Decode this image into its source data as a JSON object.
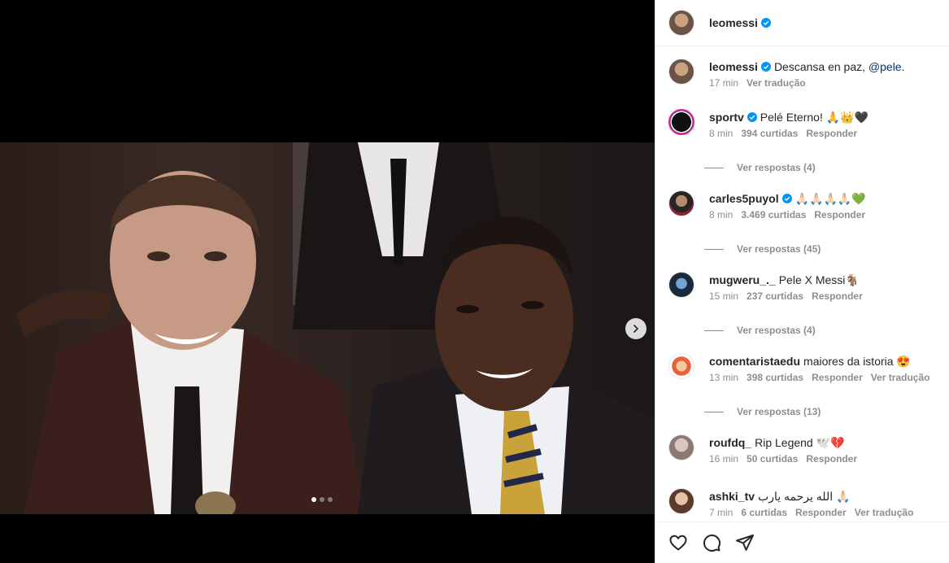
{
  "post": {
    "author": "leomessi",
    "caption_user": "leomessi",
    "caption_text": "Descansa en paz,",
    "caption_mention": "@pele",
    "caption_end": ".",
    "caption_time": "17 min",
    "caption_translate": "Ver tradução"
  },
  "carousel": {
    "slides": 3,
    "active": 1
  },
  "comments": [
    {
      "user": "sportv",
      "verified": true,
      "text": "Pelé Eterno! 🙏👑🖤",
      "time": "8 min",
      "likes": "394 curtidas",
      "reply": "Responder",
      "translate": "",
      "replies": "Ver respostas (4)"
    },
    {
      "user": "carles5puyol",
      "verified": true,
      "text": "🙏🏻🙏🏻🙏🏻🙏🏻💚",
      "time": "8 min",
      "likes": "3.469 curtidas",
      "reply": "Responder",
      "translate": "",
      "replies": "Ver respostas (45)"
    },
    {
      "user": "mugweru_._",
      "verified": false,
      "text": "Pele X Messi🐐",
      "time": "15 min",
      "likes": "237 curtidas",
      "reply": "Responder",
      "translate": "",
      "replies": "Ver respostas (4)"
    },
    {
      "user": "comentaristaedu",
      "verified": false,
      "text": "maiores da istoria 😍",
      "time": "13 min",
      "likes": "398 curtidas",
      "reply": "Responder",
      "translate": "Ver tradução",
      "replies": "Ver respostas (13)"
    },
    {
      "user": "roufdq_",
      "verified": false,
      "text": "Rip Legend 🕊️💔",
      "time": "16 min",
      "likes": "50 curtidas",
      "reply": "Responder",
      "translate": "",
      "replies": ""
    },
    {
      "user": "ashki_tv",
      "verified": false,
      "text": "الله يرحمه يارب 🙏🏻",
      "time": "7 min",
      "likes": "6 curtidas",
      "reply": "Responder",
      "translate": "Ver tradução",
      "replies": ""
    }
  ],
  "icons": {
    "like": "heart-icon",
    "comment": "comment-icon",
    "share": "share-icon",
    "next": "chevron-right-icon",
    "verified": "verified-badge-icon"
  },
  "colors": {
    "verified": "#0095f6",
    "mention": "#00376b",
    "muted": "#8e8e8e",
    "text": "#262626"
  }
}
